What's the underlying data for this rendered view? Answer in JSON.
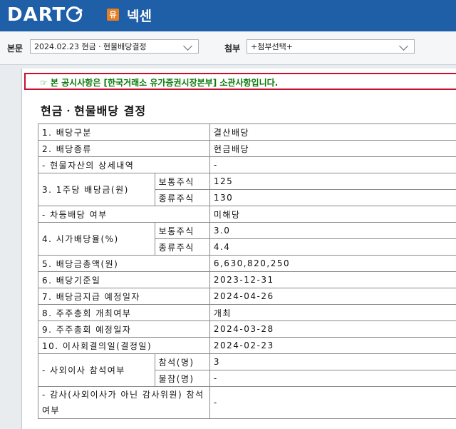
{
  "header": {
    "logo": "DART",
    "badge": "유",
    "company": "넥센"
  },
  "toolbar": {
    "main_label": "본문",
    "main_selected": "2024.02.23  현금ㆍ현물배당결정",
    "attach_label": "첨부",
    "attach_selected": "+첨부선택+"
  },
  "notice": "☞ 본 공시사항은 [한국거래소 유가증권시장본부] 소관사항입니다.",
  "doc_title": "현금ㆍ현물배당 결정",
  "rows": {
    "r1": {
      "label": "1. 배당구분",
      "value": "결산배당"
    },
    "r2": {
      "label": "2. 배당종류",
      "value": "현금배당"
    },
    "r2a": {
      "label": "- 현물자산의 상세내역",
      "value": "-"
    },
    "r3": {
      "label": "3. 1주당 배당금(원)",
      "sub1": "보통주식",
      "val1": "125",
      "sub2": "종류주식",
      "val2": "130"
    },
    "r3a": {
      "label": "- 차등배당 여부",
      "value": "미해당"
    },
    "r4": {
      "label": "4. 시가배당율(%)",
      "sub1": "보통주식",
      "val1": "3.0",
      "sub2": "종류주식",
      "val2": "4.4"
    },
    "r5": {
      "label": "5. 배당금총액(원)",
      "value": "6,630,820,250"
    },
    "r6": {
      "label": "6. 배당기준일",
      "value": "2023-12-31"
    },
    "r7": {
      "label": "7. 배당금지급 예정일자",
      "value": "2024-04-26"
    },
    "r8": {
      "label": "8. 주주총회 개최여부",
      "value": "개최"
    },
    "r9": {
      "label": "9. 주주총회 예정일자",
      "value": "2024-03-28"
    },
    "r10": {
      "label": "10. 이사회결의일(결정일)",
      "value": "2024-02-23"
    },
    "r10a": {
      "label": "- 사외이사 참석여부",
      "sub1": "참석(명)",
      "val1": "3",
      "sub2": "불참(명)",
      "val2": "-"
    },
    "r10b": {
      "label": "- 감사(사외이사가 아닌 감사위원) 참석여부",
      "value": "-"
    }
  }
}
